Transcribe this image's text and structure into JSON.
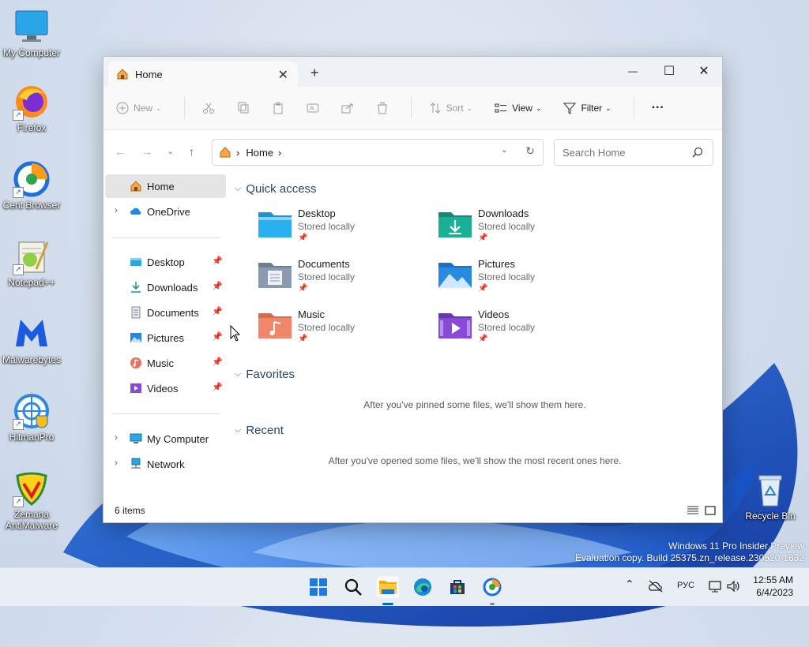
{
  "desktop": {
    "icons": [
      {
        "label": "My Computer"
      },
      {
        "label": "Firefox"
      },
      {
        "label": "Cent Browser"
      },
      {
        "label": "Notepad++"
      },
      {
        "label": "Malwarebytes"
      },
      {
        "label": "HitmanPro"
      },
      {
        "label": "Zemana\nAntiMalware"
      },
      {
        "label": "Recycle Bin"
      }
    ],
    "watermark": {
      "line1": "Windows 11 Pro Insider Preview",
      "line2": "Evaluation copy. Build 25375.zn_release.230520-1632"
    }
  },
  "window": {
    "tab_title": "Home",
    "tab_close": "✕",
    "new_tab": "+",
    "controls": {
      "minimize": "—",
      "maximize": "☐",
      "close": "✕"
    },
    "toolbar": {
      "new": "New",
      "sort": "Sort",
      "view": "View",
      "filter": "Filter",
      "more": "···"
    },
    "address": {
      "crumb": "Home",
      "sep1": "›",
      "sep2": "›"
    },
    "search": {
      "placeholder": "Search Home"
    },
    "nav": {
      "home": "Home",
      "onedrive": "OneDrive",
      "pinned": [
        "Desktop",
        "Downloads",
        "Documents",
        "Pictures",
        "Music",
        "Videos"
      ],
      "my_computer": "My Computer",
      "network": "Network"
    },
    "sections": {
      "quick_access": "Quick access",
      "favorites": "Favorites",
      "recent": "Recent"
    },
    "quick_access": [
      {
        "name": "Desktop",
        "sub": "Stored locally"
      },
      {
        "name": "Downloads",
        "sub": "Stored locally"
      },
      {
        "name": "Documents",
        "sub": "Stored locally"
      },
      {
        "name": "Pictures",
        "sub": "Stored locally"
      },
      {
        "name": "Music",
        "sub": "Stored locally"
      },
      {
        "name": "Videos",
        "sub": "Stored locally"
      }
    ],
    "favorites_empty": "After you've pinned some files, we'll show them here.",
    "recent_empty": "After you've opened some files, we'll show the most recent ones here.",
    "status": "6 items"
  },
  "taskbar": {
    "lang": "РУС",
    "time": "12:55 AM",
    "date": "6/4/2023"
  },
  "colors": {
    "accent": "#0067c0",
    "folder_blue": "#1f8fd8",
    "folder_green": "#1aa08a",
    "taskbar_bg": "#e9eef5"
  }
}
